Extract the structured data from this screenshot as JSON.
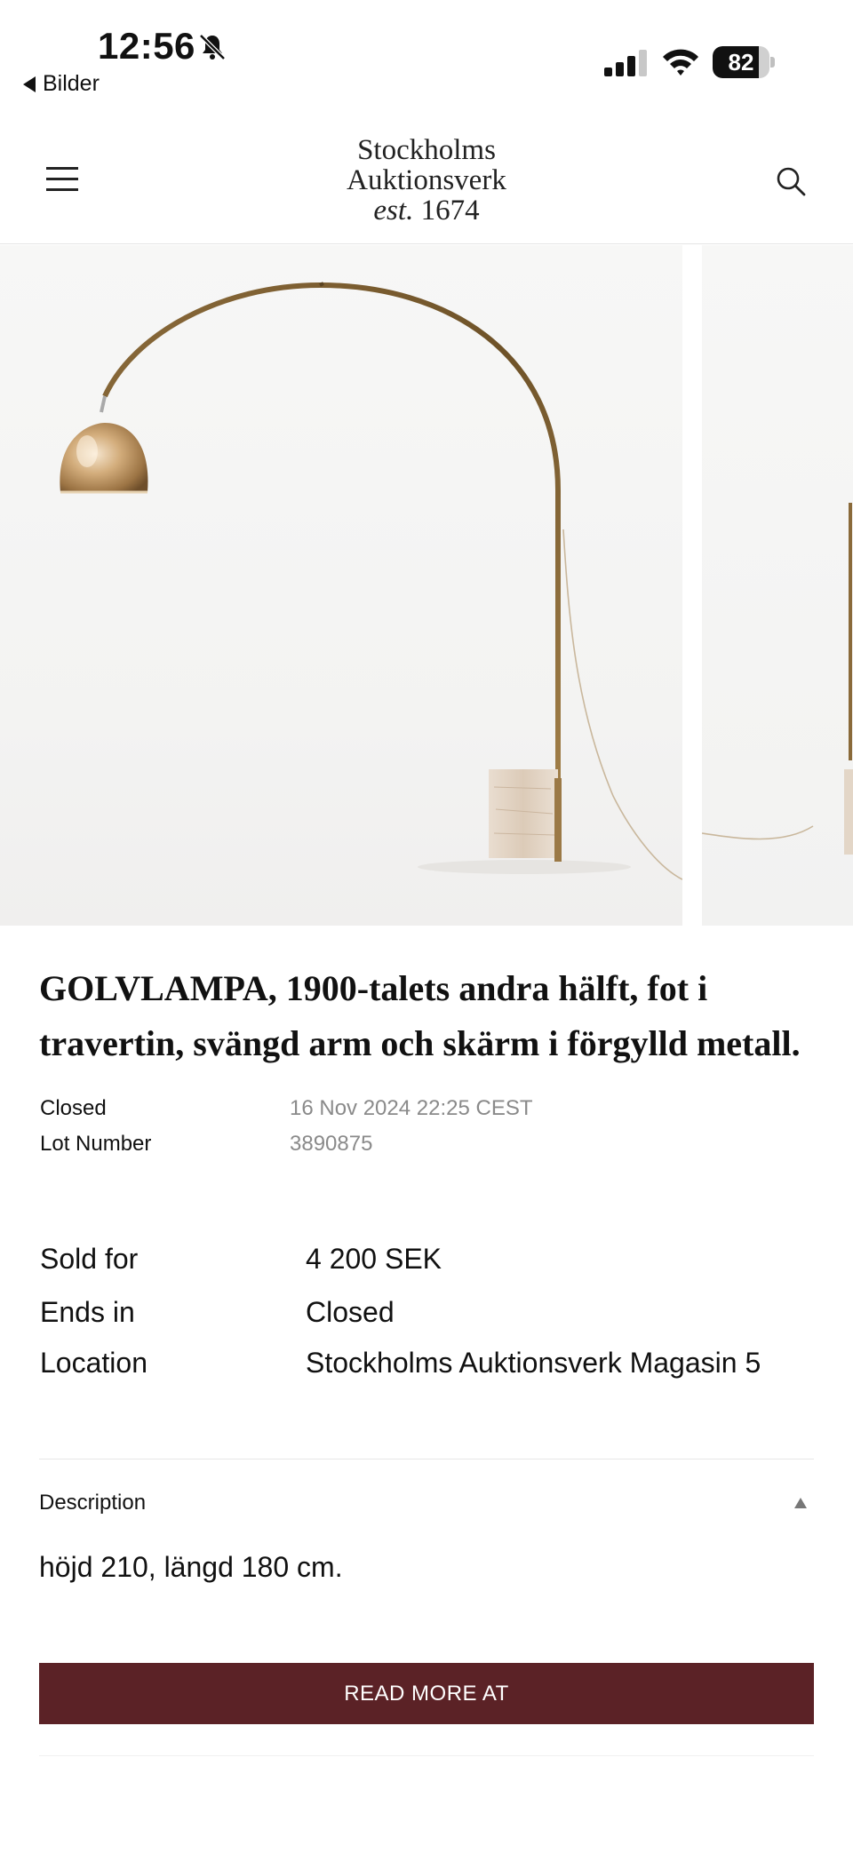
{
  "status_bar": {
    "time": "12:56",
    "back_label": "Bilder",
    "battery_level": 82,
    "battery_text": "82"
  },
  "header": {
    "logo_line1": "Stockholms",
    "logo_line2": "Auktionsverk",
    "logo_est": "est.",
    "logo_year": "1674"
  },
  "lot": {
    "title": "GOLVLAMPA, 1900-talets andra hälft, fot i travertin, svängd arm och skärm i förgylld metall.",
    "meta": [
      {
        "key": "Closed",
        "value": "16 Nov 2024 22:25 CEST"
      },
      {
        "key": "Lot Number",
        "value": "3890875"
      }
    ],
    "details": [
      {
        "key": "Sold for",
        "value": "4 200 SEK"
      },
      {
        "key": "Ends in",
        "value": "Closed"
      },
      {
        "key": "Location",
        "value": "Stockholms Auktionsverk Magasin 5"
      }
    ],
    "description_label": "Description",
    "description_text": "höjd 210, längd 180 cm.",
    "read_more_label": "READ MORE AT"
  },
  "colors": {
    "button_bg": "#5b2226",
    "meta_value": "#8a8a8a",
    "brass": "#b08a4a"
  }
}
